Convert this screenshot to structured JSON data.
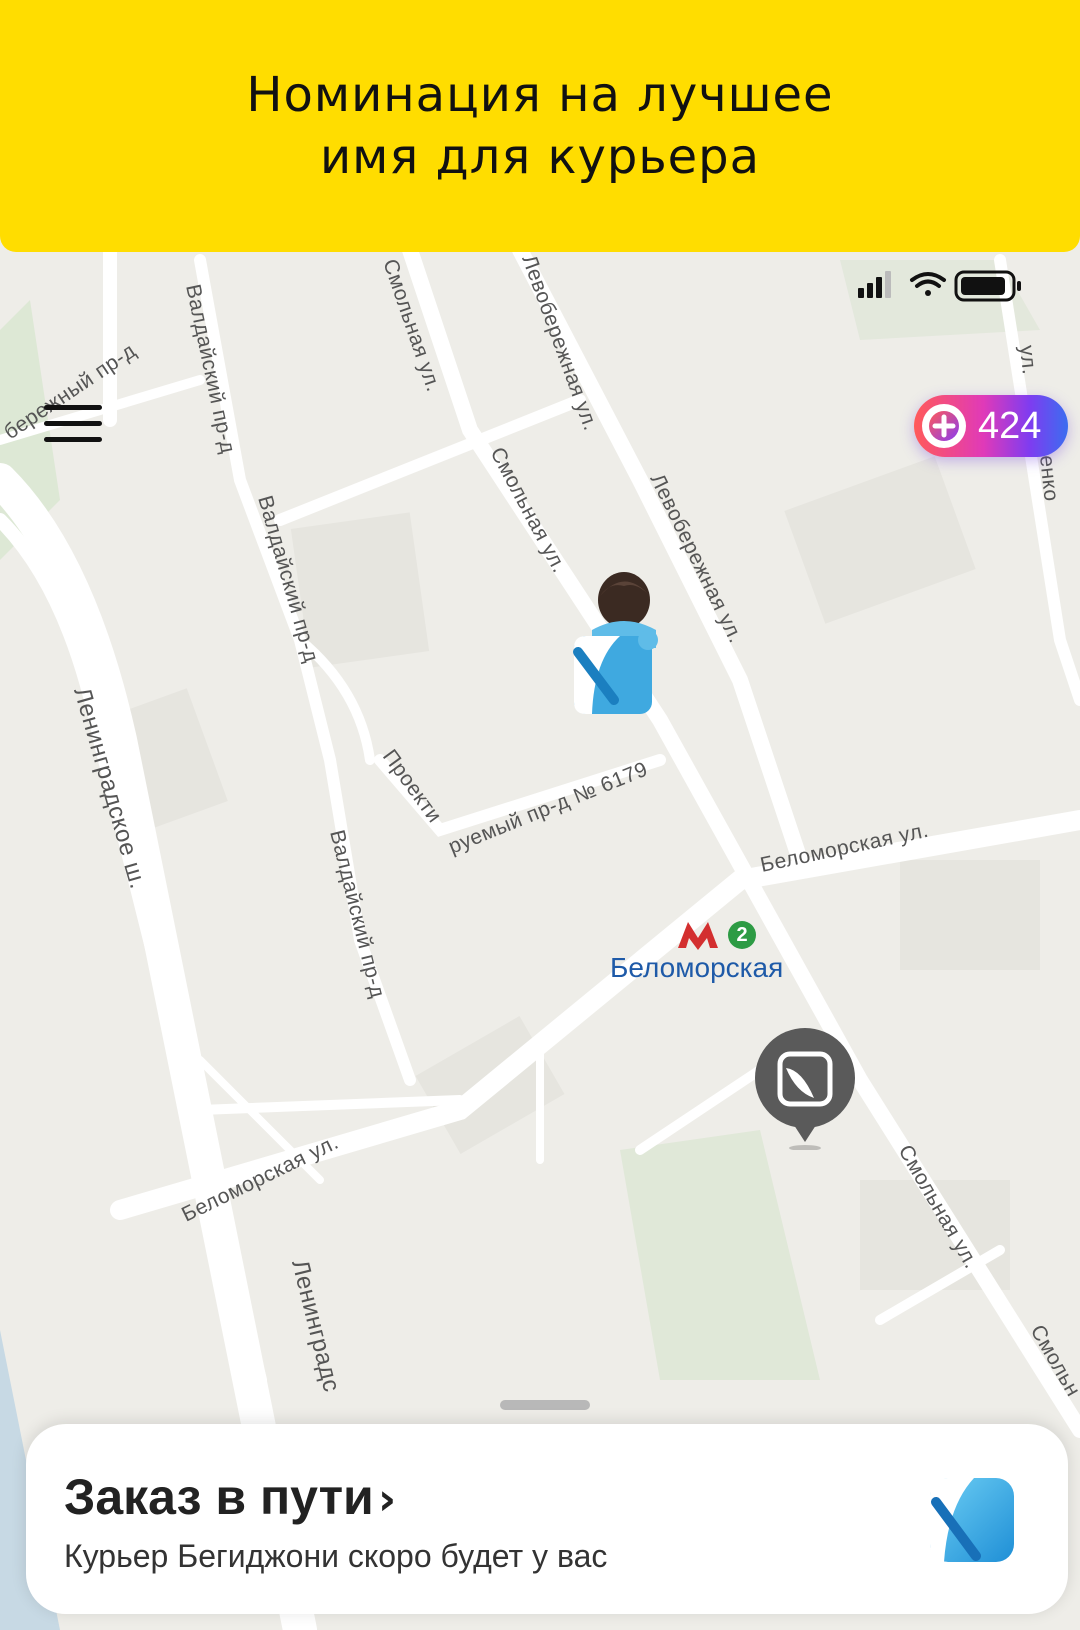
{
  "banner": {
    "line1": "Номинация на лучшее",
    "line2": "имя для курьера"
  },
  "streets": {
    "smolnaya_1": "Смольная ул.",
    "smolnaya_2": "Смольная ул.",
    "smolnaya_3": "Смольная ул.",
    "smolnaya_4": "Смольн",
    "levoberezh_1": "Левобережная ул.",
    "levoberezh_2": "Левобережная ул.",
    "valday_1": "Валдайский пр-д",
    "valday_2": "Валдайский пр-д",
    "valday_3": "Валдайский пр-д",
    "leningr_1": "Ленинградское ш.",
    "leningr_2": "Ленинградс",
    "beloms_1": "Беломорская ул.",
    "beloms_2": "Беломорская ул.",
    "proekt": "Проектируемый пр-д № 6179",
    "nabereg": "бережный пр-д",
    "ul_right": "ул.",
    "nko": "енко"
  },
  "metro": {
    "letter": "M",
    "line": "2",
    "station": "Беломорская",
    "color": "#d32f2f",
    "line_color": "#2d9b44"
  },
  "plus": {
    "points": "424",
    "icon": "plus-icon"
  },
  "menu": {
    "icon": "hamburger-menu-icon"
  },
  "order": {
    "title": "Заказ в пути",
    "chevron": "›",
    "subtitle": "Курьер Бегиджони скоро будет у вас",
    "logo_icon": "lavka-logo-icon"
  },
  "colors": {
    "banner": "#ffdd00",
    "map_bg": "#eeede8",
    "road": "#ffffff",
    "metro_label": "#1e5aa8",
    "pin": "#555555",
    "bag_blue": "#3fa9e0"
  }
}
